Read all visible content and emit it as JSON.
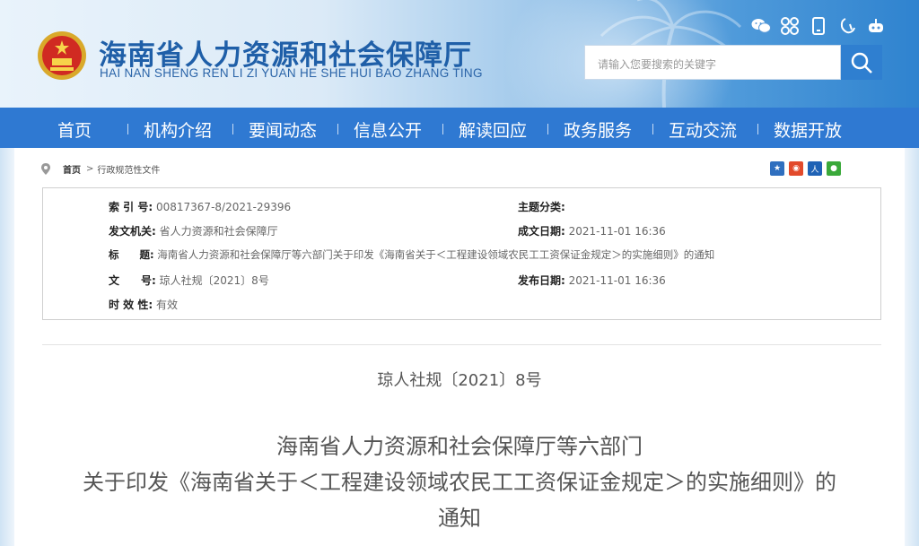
{
  "header": {
    "title_cn": "海南省人力资源和社会保障厅",
    "title_en": "HAI NAN SHENG REN LI ZI YUAN HE SHE HUI BAO ZHANG TING",
    "tools": [
      "wechat-icon",
      "app-icon",
      "mobile-icon",
      "elder-mode-icon",
      "robot-icon"
    ],
    "search_placeholder": "请输入您要搜索的关键字"
  },
  "nav": {
    "items": [
      "首页",
      "机构介绍",
      "要闻动态",
      "信息公开",
      "解读回应",
      "政务服务",
      "互动交流",
      "数据开放"
    ]
  },
  "breadcrumb": {
    "home": "首页",
    "separator": ">",
    "current": "行政规范性文件"
  },
  "share": [
    "qzone-icon",
    "weibo-icon",
    "renren-icon",
    "wechat-share-icon"
  ],
  "info": {
    "index_label": "索 引 号:",
    "index_value": "00817367-8/2021-29396",
    "topic_label": "主题分类:",
    "topic_value": "",
    "issuer_label": "发文机关:",
    "issuer_value": "省人力资源和社会保障厅",
    "date_label": "成文日期:",
    "date_value": "2021-11-01 16:36",
    "title_label": "标　　题:",
    "title_value": "海南省人力资源和社会保障厅等六部门关于印发《海南省关于＜工程建设领域农民工工资保证金规定＞的实施细则》的通知",
    "docno_label": "文　　号:",
    "docno_value": "琼人社规〔2021〕8号",
    "pubdate_label": "发布日期:",
    "pubdate_value": "2021-11-01 16:36",
    "validity_label": "时 效 性:",
    "validity_value": "有效"
  },
  "document": {
    "number": "琼人社规〔2021〕8号",
    "title_line1": "海南省人力资源和社会保障厅等六部门",
    "title_line2": "关于印发《海南省关于＜工程建设领域农民工工资保证金规定＞的实施细则》的",
    "title_line3": "通知"
  },
  "colors": {
    "nav_bg": "#2f79d2",
    "title_blue": "#1f5fa8",
    "search_btn": "#2f7fd0"
  }
}
